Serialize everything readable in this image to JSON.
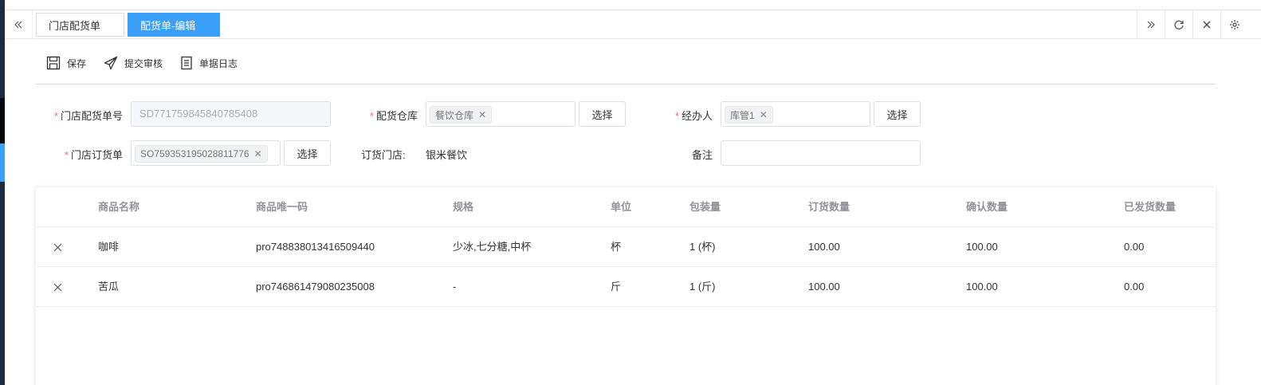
{
  "tabs": {
    "items": [
      {
        "label": "门店配货单",
        "active": false
      },
      {
        "label": "配货单-编辑",
        "active": true
      }
    ]
  },
  "toolbar": {
    "save": "保存",
    "submit": "提交审核",
    "log": "单据日志"
  },
  "form": {
    "order_no_label": "门店配货单号",
    "order_no_value": "SD771759845840785408",
    "warehouse_label": "配货仓库",
    "warehouse_chip": "餐饮仓库",
    "handler_label": "经办人",
    "handler_chip": "库管1",
    "store_order_label": "门店订货单",
    "store_order_chip": "SO759353195028811776",
    "order_store_label": "订货门店:",
    "order_store_value": "银米餐饮",
    "remark_label": "备注",
    "remark_value": "",
    "select_button": "选择"
  },
  "table": {
    "columns": [
      "商品名称",
      "商品唯一码",
      "规格",
      "单位",
      "包装量",
      "订货数量",
      "确认数量",
      "已发货数量"
    ],
    "rows": [
      [
        "咖啡",
        "pro748838013416509440",
        "少冰,七分糖,中杯",
        "杯",
        "1 (杯)",
        "100.00",
        "100.00",
        "0.00"
      ],
      [
        "苦瓜",
        "pro746861479080235008",
        "-",
        "斤",
        "1 (斤)",
        "100.00",
        "100.00",
        "0.00"
      ]
    ]
  },
  "colors": {
    "accent": "#3a9ff8",
    "required": "#f56c6c",
    "sidebar": "#1c2b3c"
  }
}
